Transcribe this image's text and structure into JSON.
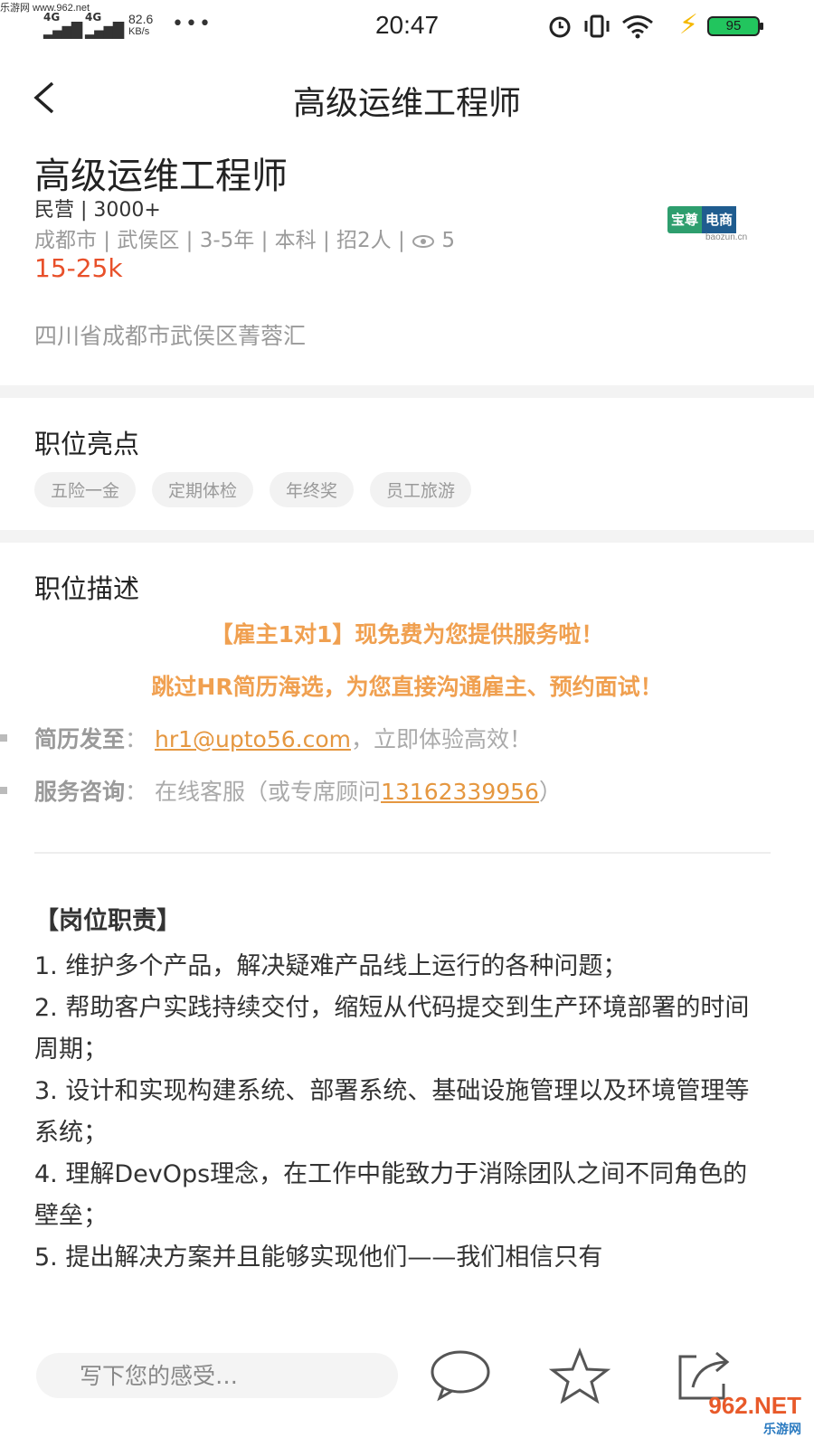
{
  "watermark_top": "乐游网 www.962.net",
  "status_bar": {
    "net1": "4G",
    "net2": "4G",
    "speed_value": "82.6",
    "speed_unit": "KB/s",
    "dots": "•••",
    "time": "20:47",
    "battery": "95"
  },
  "nav": {
    "back_glyph": "<",
    "title": "高级运维工程师"
  },
  "job": {
    "title": "高级运维工程师",
    "company": "民营 | 3000+",
    "meta": "成都市 | 武侯区 | 3-5年 | 本科 | 招2人 | ",
    "views": "5",
    "salary": "15-25k",
    "address": "四川省成都市武侯区菁蓉汇"
  },
  "logo": {
    "left": "宝尊",
    "right": "电商",
    "sub": "baozun.cn"
  },
  "highlights": {
    "title": "职位亮点",
    "tags": [
      "五险一金",
      "定期体检",
      "年终奖",
      "员工旅游"
    ]
  },
  "description": {
    "title": "职位描述",
    "promo1": "【雇主1对1】现免费为您提供服务啦！",
    "promo2": "跳过HR简历海选，为您直接沟通雇主、预约面试！",
    "resume_label": "简历发至",
    "resume_colon": "：",
    "resume_email": "hr1@upto56.com",
    "resume_suffix": "，立即体验高效！",
    "consult_label": "服务咨询",
    "consult_colon": "：",
    "consult_text": "在线客服（或专席顾问",
    "consult_phone": "13162339956",
    "consult_end": "）"
  },
  "duties": {
    "title": "【岗位职责】",
    "items": [
      "1. 维护多个产品，解决疑难产品线上运行的各种问题；",
      "2. 帮助客户实践持续交付，缩短从代码提交到生产环境部署的时间周期；",
      "3. 设计和实现构建系统、部署系统、基础设施管理以及环境管理等系统；",
      "4. 理解DevOps理念，在工作中能致力于消除团队之间不同角色的壁垒；",
      "5. 提出解决方案并且能够实现他们——我们相信只有"
    ]
  },
  "bottom_bar": {
    "comment_placeholder": "写下您的感受…"
  },
  "watermark_br": {
    "main": "962.NET",
    "sub": "乐游网"
  }
}
